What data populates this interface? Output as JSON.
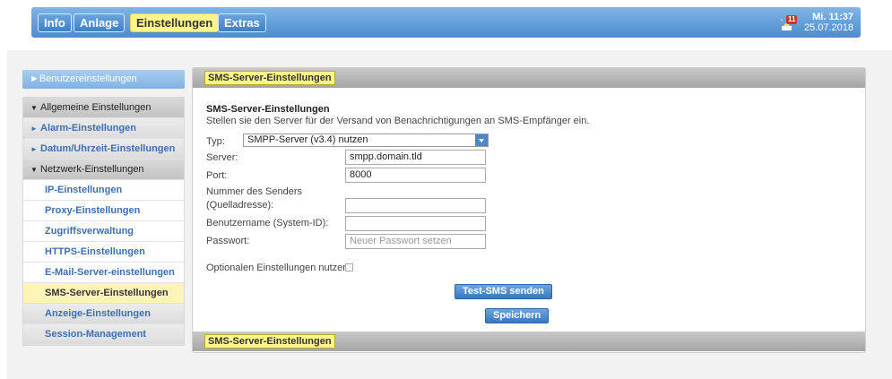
{
  "topnav": {
    "tabs": [
      {
        "label": "Info",
        "active": false
      },
      {
        "label": "Anlage",
        "active": false
      },
      {
        "label": "Einstellungen",
        "active": true
      },
      {
        "label": "Extras",
        "active": false
      }
    ],
    "alarm_count": "11",
    "clock": {
      "time": "Mi. 11:37",
      "date": "25.07.2018"
    }
  },
  "sidebar": {
    "benutzer": "Benutzereinstellungen",
    "items": [
      {
        "label": "Allgemeine Einstellungen",
        "kind": "head"
      },
      {
        "label": "Alarm-Einstellungen",
        "kind": "cat"
      },
      {
        "label": "Datum/Uhrzeit-Einstellungen",
        "kind": "cat"
      },
      {
        "label": "Netzwerk-Einstellungen",
        "kind": "head"
      },
      {
        "label": "IP-Einstellungen",
        "kind": "sub"
      },
      {
        "label": "Proxy-Einstellungen",
        "kind": "sub"
      },
      {
        "label": "Zugriffsverwaltung",
        "kind": "sub"
      },
      {
        "label": "HTTPS-Einstellungen",
        "kind": "sub"
      },
      {
        "label": "E-Mail-Server-einstellungen",
        "kind": "sub"
      },
      {
        "label": "SMS-Server-Einstellungen",
        "kind": "sub-active"
      },
      {
        "label": "Anzeige-Einstellungen",
        "kind": "grey"
      },
      {
        "label": "Session-Management",
        "kind": "grey"
      }
    ]
  },
  "main": {
    "header_label": "SMS-Server-Einstellungen",
    "footer_label": "SMS-Server-Einstellungen",
    "section_title": "SMS-Server-Einstellungen",
    "section_desc": "Stellen sie den Server für der Versand von Benachrichtigungen an SMS-Empfänger ein.",
    "form": {
      "typ_label": "Typ:",
      "typ_value": "SMPP-Server (v3.4) nutzen",
      "server_label": "Server:",
      "server_value": "smpp.domain.tld",
      "port_label": "Port:",
      "port_value": "8000",
      "sender_label_1": "Nummer des Senders",
      "sender_label_2": "(Quelladresse):",
      "sender_value": "",
      "user_label": "Benutzername (System-ID):",
      "user_value": "",
      "pw_label": "Passwort:",
      "pw_placeholder": "Neuer Passwort setzen",
      "optional_label": "Optionalen Einstellungen nutzen"
    },
    "buttons": {
      "test": "Test-SMS senden",
      "save": "Speichern"
    }
  },
  "colors": {
    "accent_blue": "#4d8ccf",
    "active_yellow": "#fff58a",
    "link_blue": "#3d6fb0",
    "alarm_red": "#c0392b"
  }
}
